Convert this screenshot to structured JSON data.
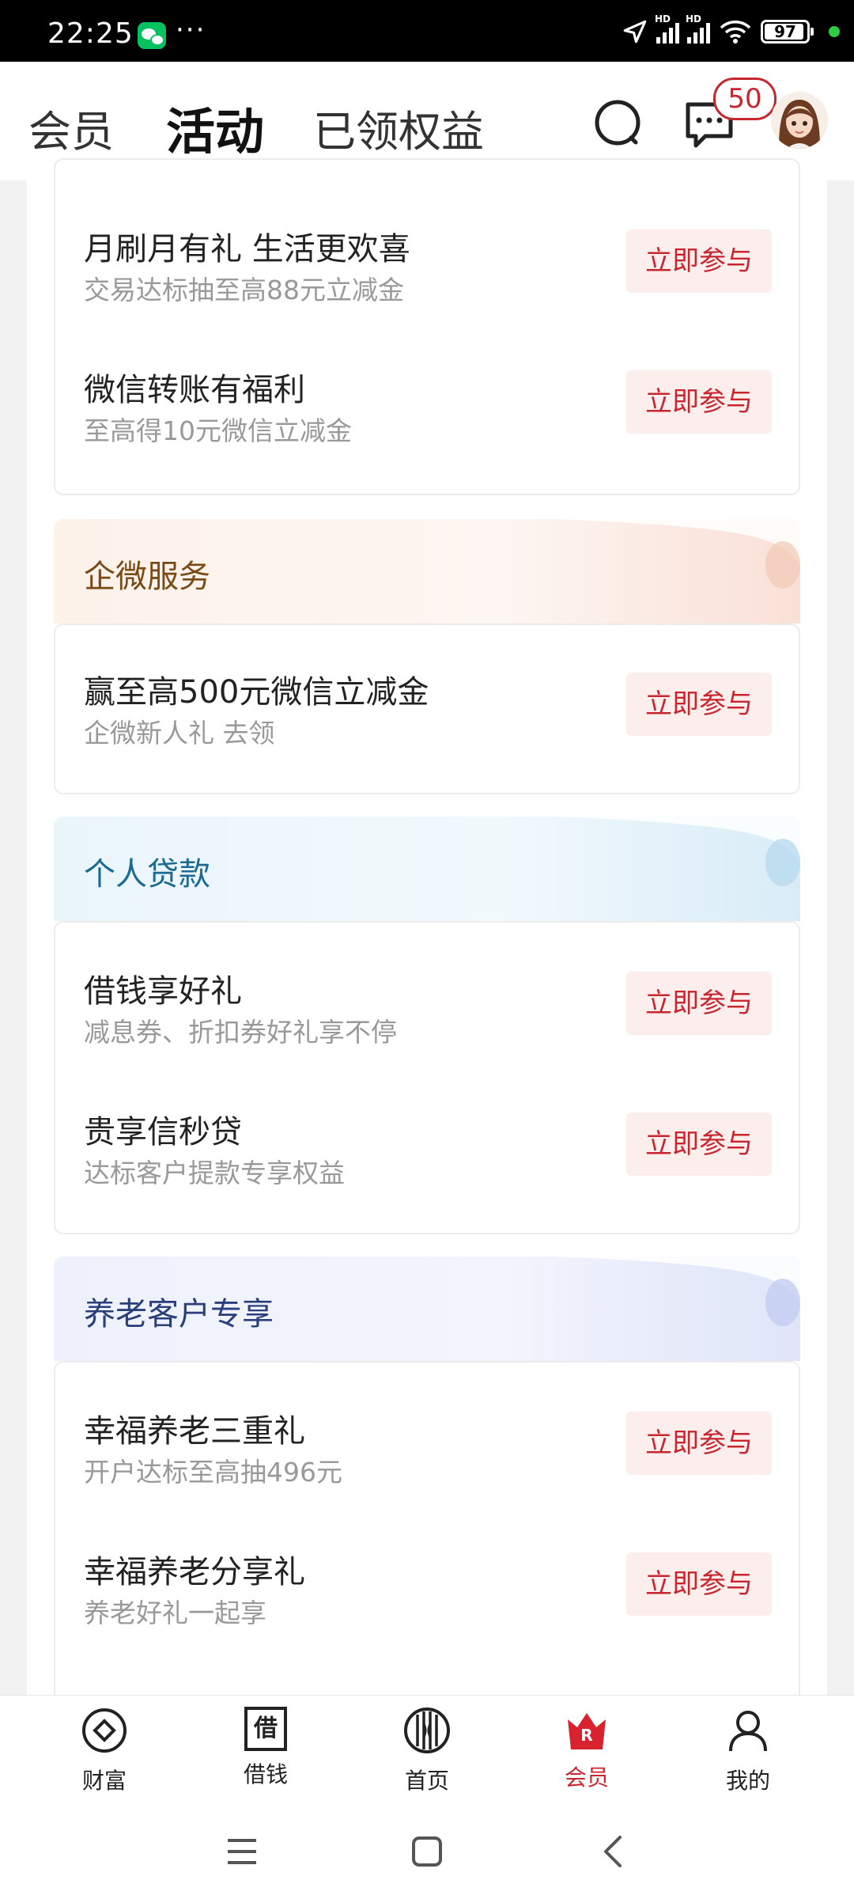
{
  "status_bar": {
    "time": "22:25",
    "notification_icons": [
      "wechat-icon"
    ],
    "more": "···",
    "battery": "97",
    "network": "HD"
  },
  "header": {
    "tabs": [
      {
        "label": "会员",
        "active": false
      },
      {
        "label": "活动",
        "active": true
      },
      {
        "label": "已领权益",
        "active": false
      }
    ],
    "message_count": "50",
    "accent_color": "#c8262e"
  },
  "cards": {
    "top": {
      "items": [
        {
          "title": "月刷月有礼 生活更欢喜",
          "subtitle": "交易达标抽至高88元立减金",
          "button": "立即参与"
        },
        {
          "title": "微信转账有福利",
          "subtitle": "至高得10元微信立减金",
          "button": "立即参与"
        }
      ]
    },
    "enterprise": {
      "header": "企微服务",
      "items": [
        {
          "title": "赢至高500元微信立减金",
          "subtitle": "企微新人礼 去领",
          "button": "立即参与"
        }
      ]
    },
    "loan": {
      "header": "个人贷款",
      "items": [
        {
          "title": "借钱享好礼",
          "subtitle": "减息券、折扣券好礼享不停",
          "button": "立即参与"
        },
        {
          "title": "贵享信秒贷",
          "subtitle": "达标客户提款专享权益",
          "button": "立即参与"
        }
      ]
    },
    "pension": {
      "header": "养老客户专享",
      "items": [
        {
          "title": "幸福养老三重礼",
          "subtitle": "开户达标至高抽496元",
          "button": "立即参与"
        },
        {
          "title": "幸福养老分享礼",
          "subtitle": "养老好礼一起享",
          "button": "立即参与"
        }
      ]
    }
  },
  "bottom_nav": {
    "items": [
      {
        "label": "财富",
        "icon": "wealth-icon"
      },
      {
        "label": "借钱",
        "icon": "borrow-icon",
        "glyph": "借"
      },
      {
        "label": "首页",
        "icon": "home-icon"
      },
      {
        "label": "会员",
        "icon": "member-crown-icon",
        "glyph": "R",
        "active": true
      },
      {
        "label": "我的",
        "icon": "profile-icon"
      }
    ]
  }
}
